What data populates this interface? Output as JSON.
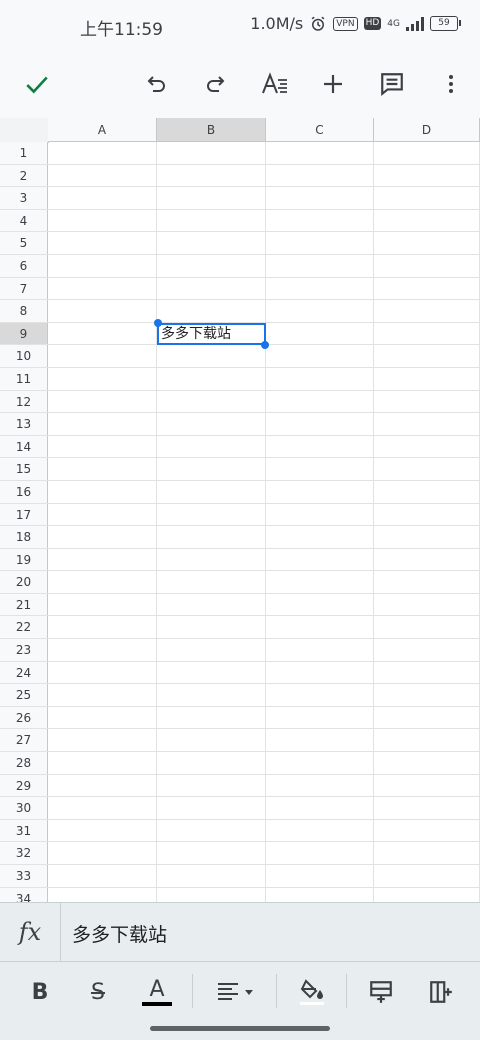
{
  "status_bar": {
    "time": "上午11:59",
    "speed": "1.0M/s",
    "vpn": "VPN",
    "hd": "HD",
    "network": "4G",
    "battery": "59"
  },
  "toolbar": {
    "icons": [
      "check-icon",
      "undo-icon",
      "redo-icon",
      "text-format-icon",
      "insert-plus-icon",
      "comment-icon",
      "more-vert-icon"
    ]
  },
  "sheet": {
    "columns": [
      "A",
      "B",
      "C",
      "D"
    ],
    "selected_column": "B",
    "selected_row": 9,
    "rows": [
      "1",
      "2",
      "3",
      "4",
      "5",
      "6",
      "7",
      "8",
      "9",
      "10",
      "11",
      "12",
      "13",
      "14",
      "15",
      "16",
      "17",
      "18",
      "19",
      "20",
      "21",
      "22",
      "23",
      "24",
      "25",
      "26",
      "27",
      "28",
      "29",
      "30",
      "31",
      "32",
      "33",
      "34"
    ],
    "cell_b9": "多多下载站"
  },
  "formula_bar": {
    "fx_label": "fx",
    "value": "多多下载站"
  },
  "format_bar": {
    "bold_label": "B",
    "strike_label": "S",
    "text_color_label": "A"
  },
  "colors": {
    "accent": "#1a73e8",
    "check": "#0b8043",
    "selected_header": "#d9d9d9"
  }
}
